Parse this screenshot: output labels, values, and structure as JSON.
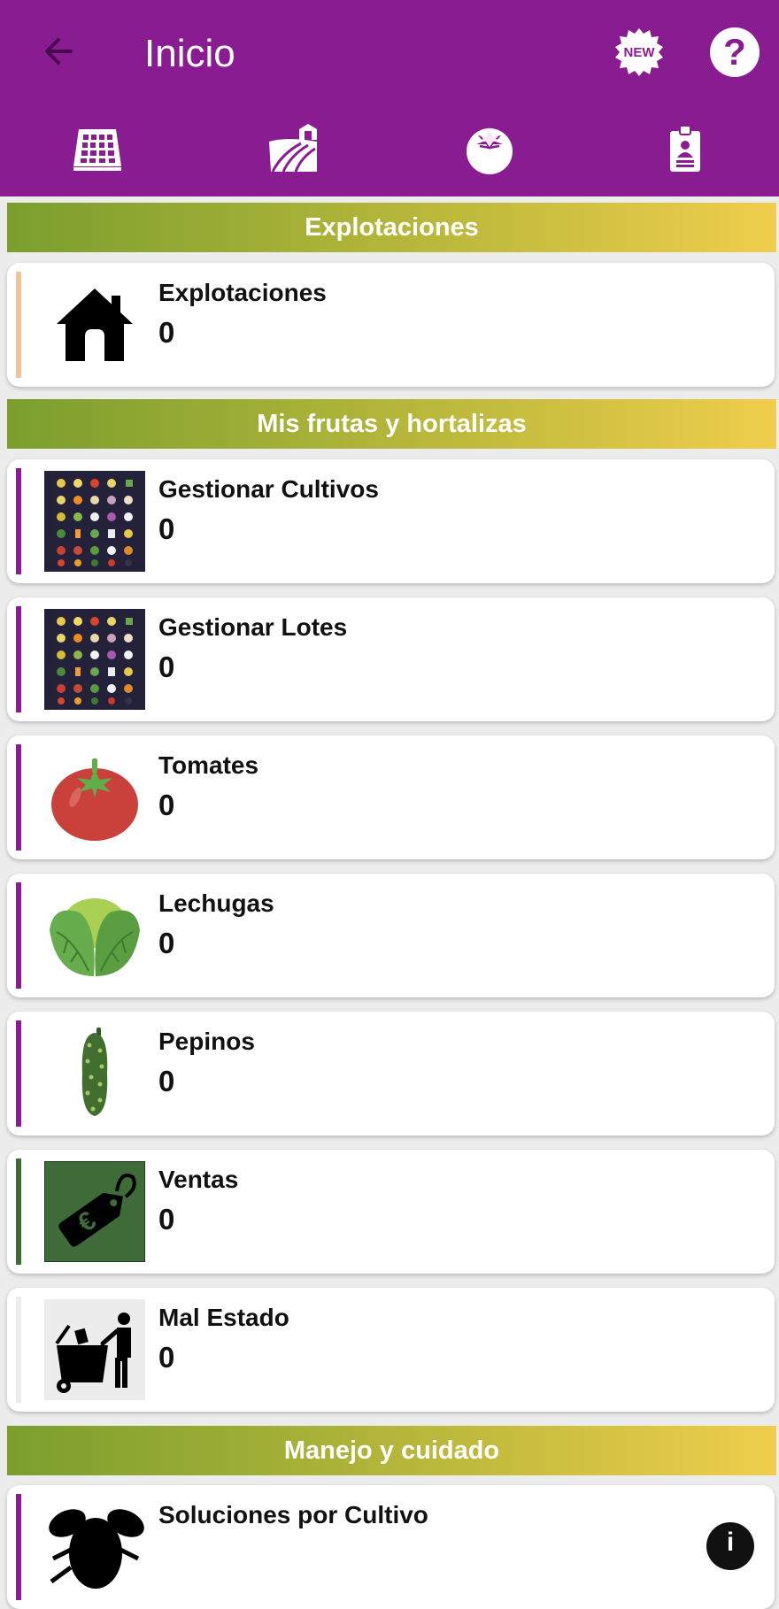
{
  "app_bar": {
    "title": "Inicio",
    "back_icon": "arrow-left-icon",
    "new_badge_text": "NEW",
    "help_text": "?"
  },
  "nav_tabs": [
    {
      "icon": "calendar-grid-icon"
    },
    {
      "icon": "farm-field-icon"
    },
    {
      "icon": "tomato-icon"
    },
    {
      "icon": "id-badge-icon"
    }
  ],
  "sections": {
    "explotaciones": {
      "label": "Explotaciones"
    },
    "frutas": {
      "label": "Mis frutas y hortalizas"
    },
    "manejo": {
      "label": "Manejo y cuidado"
    }
  },
  "cards": {
    "explotaciones": {
      "title": "Explotaciones",
      "count": "0",
      "icon": "house-icon",
      "accent": "#f0c49a"
    },
    "cultivos": {
      "title": "Gestionar Cultivos",
      "count": "0",
      "icon": "vegetables-grid-icon",
      "accent": "#8a1c92"
    },
    "lotes": {
      "title": "Gestionar Lotes",
      "count": "0",
      "icon": "vegetables-grid-icon",
      "accent": "#8a1c92"
    },
    "tomates": {
      "title": "Tomates",
      "count": "0",
      "icon": "tomato-icon",
      "accent": "#8a1c92"
    },
    "lechugas": {
      "title": "Lechugas",
      "count": "0",
      "icon": "lettuce-icon",
      "accent": "#8a1c92"
    },
    "pepinos": {
      "title": "Pepinos",
      "count": "0",
      "icon": "cucumber-icon",
      "accent": "#8a1c92"
    },
    "ventas": {
      "title": "Ventas",
      "count": "0",
      "icon": "euro-price-tag-icon",
      "accent": "#3d6b34"
    },
    "mal_estado": {
      "title": "Mal Estado",
      "count": "0",
      "icon": "trash-disposal-icon",
      "accent": "#ececec"
    },
    "soluciones": {
      "title": "Soluciones por Cultivo",
      "icon": "insect-icon",
      "accent": "#8a1c92"
    }
  },
  "info_fab": {
    "icon": "info-icon",
    "text": "i"
  },
  "colors": {
    "primary": "#8a1c92",
    "gradient_start": "#7a9e2e",
    "gradient_end": "#f0cd4c"
  }
}
